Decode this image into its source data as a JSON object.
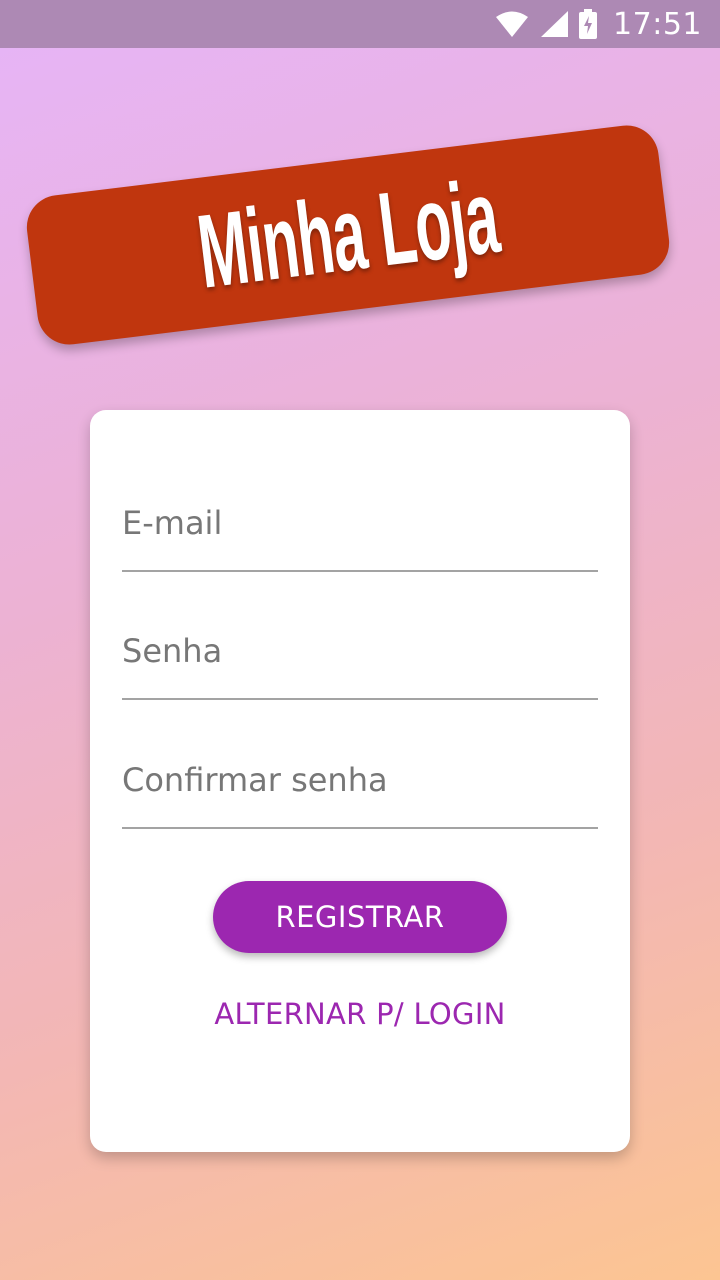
{
  "status_bar": {
    "time": "17:51",
    "icons": [
      "wifi-icon",
      "signal-icon",
      "battery-charging-icon"
    ]
  },
  "banner": {
    "title": "Minha Loja",
    "color": "#c0360e"
  },
  "form": {
    "email_placeholder": "E-mail",
    "password_placeholder": "Senha",
    "confirm_placeholder": "Confirmar senha",
    "register_label": "REGISTRAR",
    "toggle_label": "ALTERNAR P/ LOGIN",
    "accent_color": "#9c27b0"
  }
}
